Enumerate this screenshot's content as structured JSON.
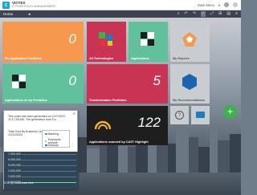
{
  "header": {
    "logo_text": "C",
    "app_name": "VIOTEX",
    "app_subtitle": "IT PORTFOLIO MANAGEMENT",
    "main_menu_label": "Main Menu",
    "user_icon": "user-icon",
    "help_icon": "help-icon"
  },
  "subbar": {
    "home_label": "Home",
    "back_icon": "chevron-left-icon",
    "tools": [
      "⌕",
      "↶",
      "↷",
      "✓",
      "⤢",
      "⊞",
      "▤",
      "≡"
    ]
  },
  "tiles": [
    {
      "id": "fix-app-portfolios",
      "label": "Fix Application Portfolios",
      "value": "0",
      "color": "#f6994e"
    },
    {
      "id": "all-technologies",
      "label": "All Technologies",
      "value": "",
      "color": "#c93455"
    },
    {
      "id": "applications",
      "label": "Applications",
      "value": "",
      "color": "#62c19d"
    },
    {
      "id": "my-reports",
      "label": "My Reports",
      "value": "",
      "color": "#f6994e"
    },
    {
      "id": "applications-of-my-portfolios",
      "label": "Applications of my Portfolios",
      "value": "0",
      "color": "#62c19d"
    },
    {
      "id": "transformation-portfolios",
      "label": "Transformation Portfolios",
      "value": "5",
      "color": "#c93455"
    },
    {
      "id": "applications-scanned-cast",
      "label": "Applications scanned by CAST Highlight",
      "value": "122",
      "color": "#1e1e1e"
    },
    {
      "id": "my-recommendations",
      "label": "My Recommendations",
      "value": "",
      "color": "#a9d0e6"
    }
  ],
  "popover": {
    "line1": "This chart has been generated on 12/7/2023 11:17:09 AM. The generation took 5 s.",
    "line2": "Total Cost By Business Line From 1/1/2013 to 12/31/2023",
    "y_ticks": [
      "7,000,000",
      "6,000,000",
      "5,000,000",
      "4,000,000",
      "3,000,000",
      "2,000,000"
    ],
    "legend": [
      {
        "label": "Banking",
        "color": "#3fb14c"
      },
      {
        "label": "Employee website",
        "color": "#8ecfe0"
      },
      {
        "label": "Industry",
        "color": "#2a7abf"
      }
    ],
    "title": "TCO by Business Line",
    "more_icon": "more-icon"
  },
  "fab": {
    "label": "+"
  }
}
